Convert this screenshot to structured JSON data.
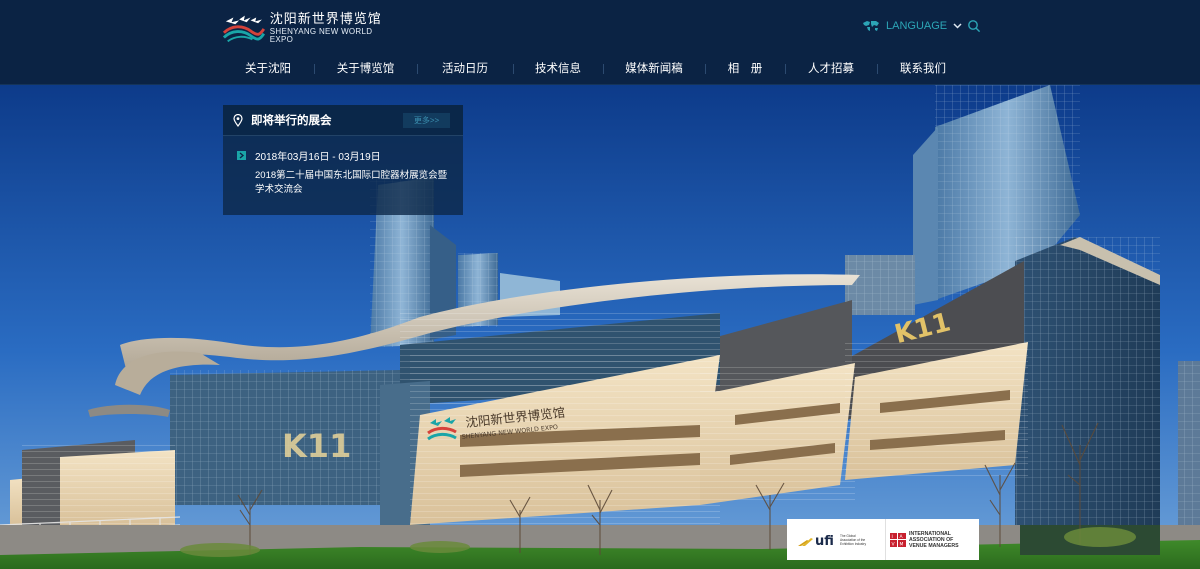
{
  "brand": {
    "name_cn": "沈阳新世界博览馆",
    "name_en": "SHENYANG NEW WORLD EXPO",
    "colors": {
      "header": "#0b2344",
      "accent": "#2ca5b6",
      "logo_red": "#d6423a",
      "logo_teal": "#1aa5a8"
    }
  },
  "header": {
    "language_label": "LANGUAGE",
    "icons": {
      "language": "globe-icon",
      "chevron": "chevron-down-icon",
      "search": "search-icon"
    }
  },
  "nav": {
    "items": [
      {
        "label": "关于沈阳"
      },
      {
        "label": "关于博览馆"
      },
      {
        "label": "活动日历"
      },
      {
        "label": "技术信息"
      },
      {
        "label": "媒体新闻稿"
      },
      {
        "label": "相　册"
      },
      {
        "label": "人才招募"
      },
      {
        "label": "联系我们"
      }
    ]
  },
  "upcoming": {
    "title": "即将举行的展会",
    "more_label": "更多>>",
    "events": [
      {
        "date": "2018年03月16日  -  03月19日",
        "name": "2018第二十届中国东北国际口腔器材展览会暨学术交流会"
      }
    ]
  },
  "hero": {
    "building_sign_cn": "沈阳新世界博览馆",
    "building_sign_en": "SHENYANG NEW WORLD EXPO",
    "tower_sign": "K11",
    "podium_sign": "K11"
  },
  "badges": {
    "ufi": {
      "name": "ufi",
      "tagline": "The Global Association of the Exhibition Industry"
    },
    "iavm": {
      "name": "INTERNATIONAL ASSOCIATION OF VENUE MANAGERS"
    }
  }
}
